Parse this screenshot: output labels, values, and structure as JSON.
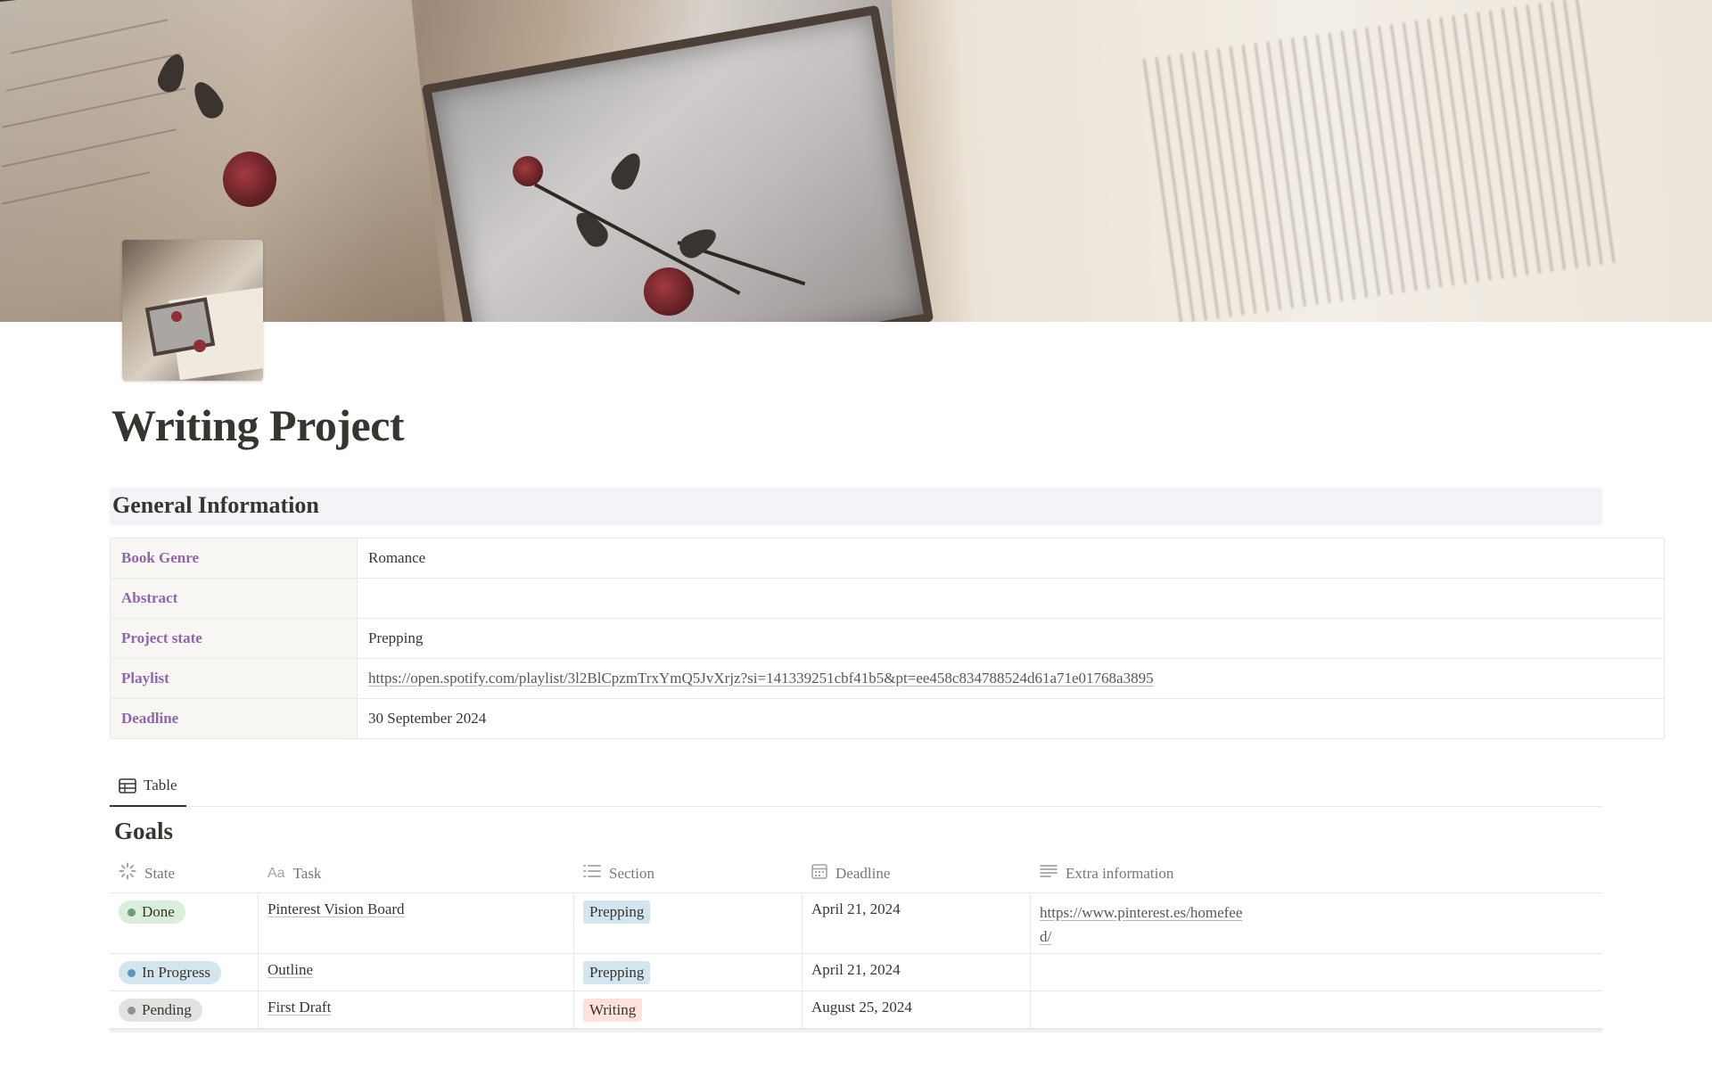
{
  "page": {
    "title": "Writing Project"
  },
  "general_info": {
    "heading": "General Information",
    "rows": [
      {
        "key": "Book Genre",
        "value": "Romance"
      },
      {
        "key": "Abstract",
        "value": ""
      },
      {
        "key": "Project state",
        "value": "Prepping"
      },
      {
        "key": "Playlist",
        "value": "https://open.spotify.com/playlist/3l2BlCpzmTrxYmQ5JvXrjz?si=141339251cbf41b5&pt=ee458c834788524d61a71e01768a3895"
      },
      {
        "key": "Deadline",
        "value": "30 September 2024"
      }
    ]
  },
  "views": {
    "tabs": [
      {
        "label": "Table",
        "icon": "table-icon"
      }
    ]
  },
  "goals": {
    "title": "Goals",
    "columns": [
      {
        "label": "State",
        "icon": "status-icon"
      },
      {
        "label": "Task",
        "icon": "text-aa-icon"
      },
      {
        "label": "Section",
        "icon": "list-icon"
      },
      {
        "label": "Deadline",
        "icon": "calendar-icon"
      },
      {
        "label": "Extra information",
        "icon": "lines-icon"
      }
    ],
    "rows": [
      {
        "state": "Done",
        "task": "Pinterest Vision Board",
        "section": "Prepping",
        "deadline": "April 21, 2024",
        "extra": "https://www.pinterest.es/homefeed/"
      },
      {
        "state": "In Progress",
        "task": "Outline",
        "section": "Prepping",
        "deadline": "April 21, 2024",
        "extra": ""
      },
      {
        "state": "Pending",
        "task": "First Draft",
        "section": "Writing",
        "deadline": "August 25, 2024",
        "extra": ""
      }
    ]
  },
  "colors": {
    "property_key": "#9065b0",
    "done_bg": "#dbeddb",
    "done_dot": "#6c9b7d",
    "progress_bg": "#d3e5ef",
    "progress_dot": "#5b97bd",
    "pending_bg": "#e3e2e0",
    "pending_dot": "#91918e",
    "prepping_tag": "#d3e5ef",
    "writing_tag": "#ffe2dd"
  }
}
